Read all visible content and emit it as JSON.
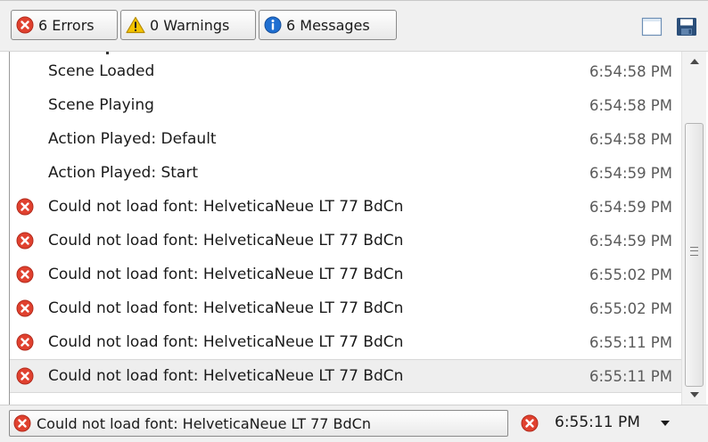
{
  "toolbar": {
    "errors_label": "6 Errors",
    "warnings_label": "0 Warnings",
    "messages_label": "6 Messages",
    "icons": [
      "error-icon",
      "warning-icon",
      "info-icon",
      "clear-log-icon",
      "save-icon"
    ]
  },
  "log": {
    "rows": [
      {
        "type": "message",
        "text": "Scene Loaded",
        "time": "6:54:58 PM"
      },
      {
        "type": "message",
        "text": "Scene Playing",
        "time": "6:54:58 PM"
      },
      {
        "type": "message",
        "text": "Action Played: Default",
        "time": "6:54:58 PM"
      },
      {
        "type": "message",
        "text": "Action Played: Start",
        "time": "6:54:59 PM"
      },
      {
        "type": "error",
        "text": "Could not load font: HelveticaNeue LT 77 BdCn",
        "time": "6:54:59 PM"
      },
      {
        "type": "error",
        "text": "Could not load font: HelveticaNeue LT 77 BdCn",
        "time": "6:54:59 PM"
      },
      {
        "type": "error",
        "text": "Could not load font: HelveticaNeue LT 77 BdCn",
        "time": "6:55:02 PM"
      },
      {
        "type": "error",
        "text": "Could not load font: HelveticaNeue LT 77 BdCn",
        "time": "6:55:02 PM"
      },
      {
        "type": "error",
        "text": "Could not load font: HelveticaNeue LT 77 BdCn",
        "time": "6:55:11 PM"
      },
      {
        "type": "error",
        "text": "Could not load font: HelveticaNeue LT 77 BdCn",
        "time": "6:55:11 PM",
        "selected": true
      }
    ]
  },
  "status": {
    "text": "Could not load font: HelveticaNeue LT 77 BdCn",
    "time": "6:55:11 PM"
  },
  "colors": {
    "error_red": "#e0412f",
    "warning_yellow": "#f5c400",
    "info_blue": "#1f6fd1"
  }
}
